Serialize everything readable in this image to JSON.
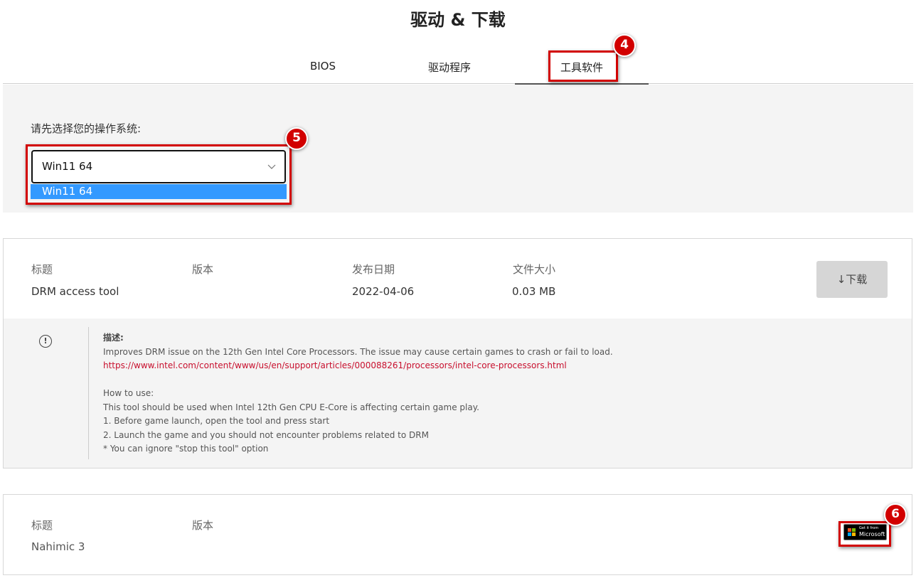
{
  "page": {
    "title": "驱动 & 下载"
  },
  "tabs": [
    {
      "label": "BIOS",
      "active": false
    },
    {
      "label": "驱动程序",
      "active": false
    },
    {
      "label": "工具软件",
      "active": true
    }
  ],
  "os_selector": {
    "label": "请先选择您的操作系统:",
    "selected": "Win11 64",
    "options": [
      "Win11 64"
    ]
  },
  "cards": [
    {
      "headers": {
        "title": "标题",
        "version": "版本",
        "date": "发布日期",
        "size": "文件大小"
      },
      "title": "DRM access tool",
      "version": "",
      "date": "2022-04-06",
      "size": "0.03 MB",
      "download_label": "↓下载",
      "description": {
        "label": "描述:",
        "line1": "Improves DRM issue on the 12th Gen Intel Core Processors. The issue may cause certain games to crash or fail to load.",
        "link": "https://www.intel.com/content/www/us/en/support/articles/000088261/processors/intel-core-processors.html",
        "howto_label": "How to use:",
        "howto_lines": [
          "This tool should be used when Intel 12th Gen CPU E-Core is affecting certain game play.",
          "1. Before game launch, open the tool and press start",
          "2. Launch the game and you should not encounter problems related to DRM",
          "* You can ignore \"stop this tool\" option"
        ]
      }
    },
    {
      "headers": {
        "title": "标题",
        "version": "版本"
      },
      "title": "Nahimic 3",
      "version": "",
      "store_badge": {
        "line1": "Get it from",
        "line2": "Microsoft"
      }
    }
  ],
  "annotations": [
    {
      "number": "4",
      "target": "tools-tab"
    },
    {
      "number": "5",
      "target": "os-select"
    },
    {
      "number": "6",
      "target": "microsoft-store-badge"
    }
  ],
  "colors": {
    "highlight": "#d20000",
    "link": "#c8102e",
    "option_selected": "#3399ff",
    "panel_bg": "#f4f4f4",
    "microsoft_logo": [
      "#f25022",
      "#7fba00",
      "#00a4ef",
      "#ffb900"
    ]
  }
}
